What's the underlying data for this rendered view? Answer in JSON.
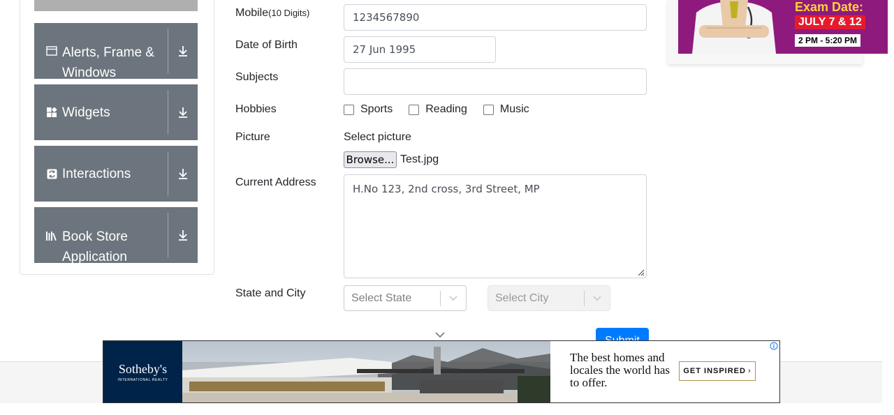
{
  "sidebar": {
    "groups": [
      {
        "label": "Alerts, Frame & Windows",
        "icon": "window-icon"
      },
      {
        "label": "Widgets",
        "icon": "widgets-icon"
      },
      {
        "label": "Interactions",
        "icon": "interactions-icon"
      },
      {
        "label": "Book Store Application",
        "icon": "books-icon"
      }
    ],
    "expand_icon": "download-arrow-icon"
  },
  "form": {
    "mobile": {
      "label": "Mobile",
      "hint": "(10 Digits)",
      "value": "1234567890"
    },
    "dob": {
      "label": "Date of Birth",
      "value": "27 Jun 1995"
    },
    "subjects": {
      "label": "Subjects",
      "value": ""
    },
    "hobbies": {
      "label": "Hobbies",
      "options": [
        {
          "label": "Sports",
          "checked": false
        },
        {
          "label": "Reading",
          "checked": false
        },
        {
          "label": "Music",
          "checked": false
        }
      ]
    },
    "picture": {
      "label": "Picture",
      "caption": "Select picture",
      "button": "Browse...",
      "filename": "Test.jpg"
    },
    "address": {
      "label": "Current Address",
      "value": "H.No 123, 2nd cross, 3rd Street, MP"
    },
    "state_city": {
      "label": "State and City",
      "state_placeholder": "Select State",
      "city_placeholder": "Select City"
    },
    "submit": "Submit"
  },
  "right_ad": {
    "headline": "Exam Date:",
    "date": "JULY 7 & 12",
    "time": "2 PM - 5:20 PM"
  },
  "bottom_ad": {
    "brand": "Sotheby's",
    "brand_sub": "INTERNATIONAL REALTY",
    "tagline": "The best homes and locales the world has to offer.",
    "cta": "GET INSPIRED"
  },
  "colors": {
    "sidebar_group": "#6c757d",
    "primary": "#007bff",
    "ad_purple": "#8e1a7d",
    "sothebys_navy": "#002349"
  }
}
